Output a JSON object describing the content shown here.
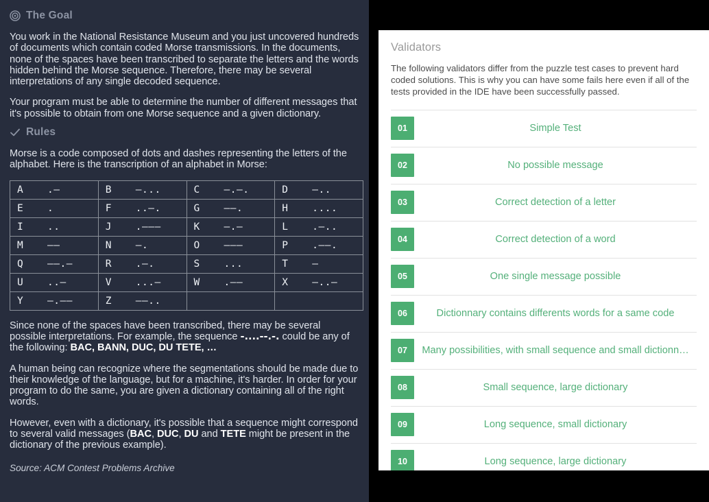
{
  "statement": {
    "goal": {
      "icon": "target-icon",
      "heading": "The Goal",
      "paragraphs": [
        "You work in the National Resistance Museum and you just uncovered hundreds of documents which contain coded Morse transmissions. In the documents, none of the spaces have been transcribed to separate the letters and the words hidden behind the Morse sequence. Therefore, there may be several interpretations of any single decoded sequence.",
        "Your program must be able to determine the number of different messages that it's possible to obtain from one Morse sequence and a given dictionary."
      ]
    },
    "rules": {
      "icon": "check-icon",
      "heading": "Rules",
      "intro": "Morse is a code composed of dots and dashes representing the letters of the alphabet. Here is the transcription of an alphabet in Morse:",
      "morse_table": [
        [
          {
            "letter": "A",
            "code": ".—"
          },
          {
            "letter": "B",
            "code": "—..."
          },
          {
            "letter": "C",
            "code": "—.—."
          },
          {
            "letter": "D",
            "code": "—.."
          }
        ],
        [
          {
            "letter": "E",
            "code": "."
          },
          {
            "letter": "F",
            "code": "..—."
          },
          {
            "letter": "G",
            "code": "——."
          },
          {
            "letter": "H",
            "code": "...."
          }
        ],
        [
          {
            "letter": "I",
            "code": ".."
          },
          {
            "letter": "J",
            "code": ".———"
          },
          {
            "letter": "K",
            "code": "—.—"
          },
          {
            "letter": "L",
            "code": ".—.."
          }
        ],
        [
          {
            "letter": "M",
            "code": "——"
          },
          {
            "letter": "N",
            "code": "—."
          },
          {
            "letter": "O",
            "code": "———"
          },
          {
            "letter": "P",
            "code": ".——."
          }
        ],
        [
          {
            "letter": "Q",
            "code": "——.—"
          },
          {
            "letter": "R",
            "code": ".—."
          },
          {
            "letter": "S",
            "code": "..."
          },
          {
            "letter": "T",
            "code": "—"
          }
        ],
        [
          {
            "letter": "U",
            "code": "..—"
          },
          {
            "letter": "V",
            "code": "...—"
          },
          {
            "letter": "W",
            "code": ".——"
          },
          {
            "letter": "X",
            "code": "—..—"
          }
        ],
        [
          {
            "letter": "Y",
            "code": "—.——"
          },
          {
            "letter": "Z",
            "code": "——.."
          },
          {
            "letter": "",
            "code": ""
          },
          {
            "letter": "",
            "code": ""
          }
        ]
      ],
      "example_paragraph": {
        "lead": "Since none of the spaces have been transcribed, there may be several possible interpretations. For example, the sequence ",
        "sequence": "-....--.-.",
        "middle": " could be any of the following: ",
        "words": "BAC, BANN, DUC, DU TETE, …"
      },
      "human_paragraph": "A human being can recognize where the segmentations should be made due to their knowledge of the language, but for a machine, it's harder. In order for your program to do the same, you are given a dictionary containing all of the right words.",
      "ambiguity_paragraph": {
        "lead": "However, even with a dictionary, it's possible that a sequence might correspond to several valid messages (",
        "w1": "BAC",
        "sep1": ", ",
        "w2": "DUC",
        "sep2": ", ",
        "w3": "DU",
        "sep3": " and ",
        "w4": "TETE",
        "tail": " might be present in the dictionary of the previous example)."
      },
      "source": "Source: ACM Contest Problems Archive"
    }
  },
  "validators": {
    "title": "Validators",
    "description": "The following validators differ from the puzzle test cases to prevent hard coded solutions. This is why you can have some fails here even if all of the tests provided in the IDE have been successfully passed.",
    "accent_color": "#4cae72",
    "items": [
      {
        "number": "01",
        "name": "Simple Test"
      },
      {
        "number": "02",
        "name": "No possible message"
      },
      {
        "number": "03",
        "name": "Correct detection of a letter"
      },
      {
        "number": "04",
        "name": "Correct detection of a word"
      },
      {
        "number": "05",
        "name": "One single message possible"
      },
      {
        "number": "06",
        "name": "Dictionnary contains differents words for a same code"
      },
      {
        "number": "07",
        "name": "Many possibilities, with small sequence and small dictionn…"
      },
      {
        "number": "08",
        "name": "Small sequence, large dictionary"
      },
      {
        "number": "09",
        "name": "Long sequence, small dictionary"
      },
      {
        "number": "10",
        "name": "Long sequence, large dictionary"
      }
    ]
  }
}
